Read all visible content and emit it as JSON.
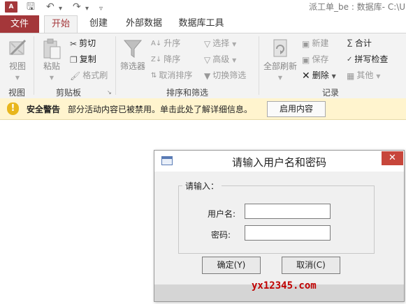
{
  "titlebar": {
    "app_logo": "A",
    "window_title": "派工单_be : 数据库- C:\\U",
    "quick_access": {
      "save_icon": "save-icon",
      "undo_icon": "undo-icon",
      "redo_icon": "redo-icon"
    }
  },
  "tabs": {
    "file": "文件",
    "items": [
      "开始",
      "创建",
      "外部数据",
      "数据库工具"
    ],
    "active": "开始"
  },
  "ribbon": {
    "groups": {
      "views": {
        "label": "视图",
        "view_button": "视图"
      },
      "clipboard": {
        "label": "剪贴板",
        "paste": "粘贴",
        "cut": "剪切",
        "copy": "复制",
        "format_painter": "格式刷"
      },
      "sort_filter": {
        "label": "排序和筛选",
        "filter": "筛选器",
        "ascending": "升序",
        "descending": "降序",
        "clear_sort": "取消排序",
        "selection": "选择",
        "advanced": "高级",
        "toggle_filter": "切换筛选"
      },
      "records": {
        "label": "记录",
        "refresh_all": "全部刷新",
        "new": "新建",
        "save": "保存",
        "delete": "删除",
        "totals": "合计",
        "spelling": "拼写检查",
        "more": "其他"
      }
    }
  },
  "message_bar": {
    "title": "安全警告",
    "text": "部分活动内容已被禁用。单击此处了解详细信息。",
    "button": "启用内容"
  },
  "dialog": {
    "title": "请输入用户名和密码",
    "close": "✕",
    "group_label": "请输入：",
    "username_label": "用户名:",
    "username_value": "",
    "password_label": "密码:",
    "password_value": "",
    "ok_button": "确定(Y)",
    "cancel_button": "取消(C)"
  },
  "watermark": "yx12345.com",
  "colors": {
    "accent": "#a4373a",
    "message_bar": "#fff4ce",
    "close_button": "#c7463b"
  }
}
